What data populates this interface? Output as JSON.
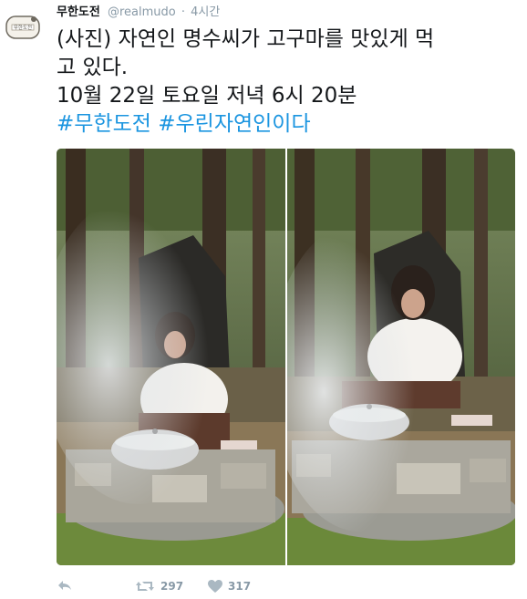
{
  "tweet": {
    "display_name": "무한도전",
    "handle": "@realmudo",
    "separator": "·",
    "timestamp": "4시간",
    "text_lines": [
      "(사진) 자연인 명수씨가 고구마를 맛있게 먹",
      "고 있다.",
      "10월 22일 토요일 저녁 6시 20분"
    ],
    "hashtags": [
      "#무한도전",
      "#우린자연인이다"
    ],
    "avatar_text": "무한도전",
    "retweet_count": "297",
    "like_count": "317"
  },
  "icons": {
    "reply": "reply-icon",
    "retweet": "retweet-icon",
    "like": "heart-icon"
  },
  "colors": {
    "link": "#1b95e0",
    "meta": "#8899a6",
    "text": "#14171a"
  }
}
